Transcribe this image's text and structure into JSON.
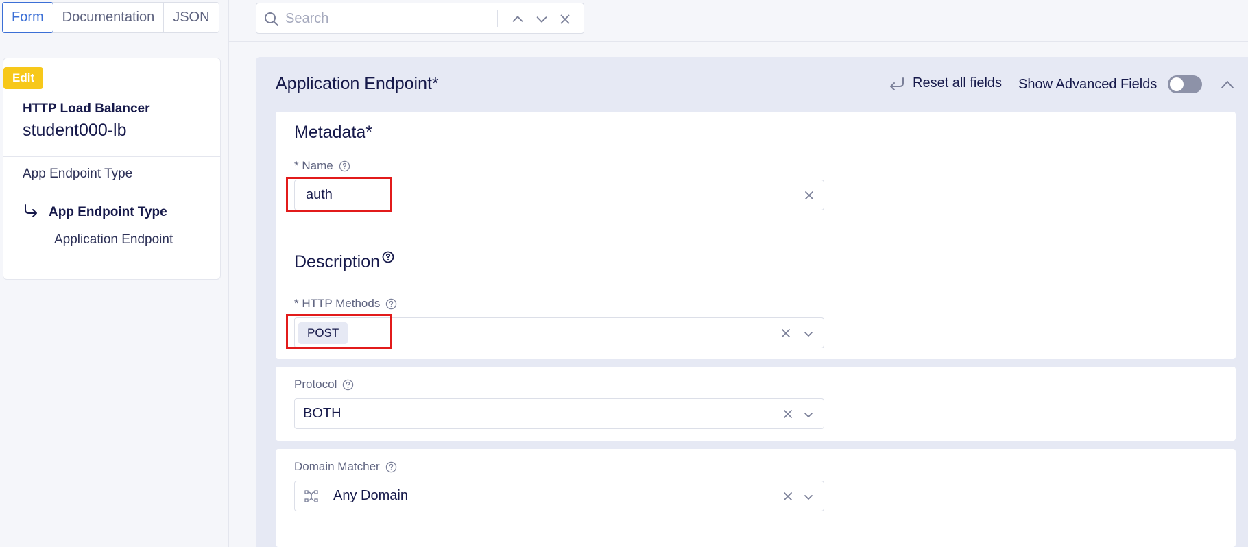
{
  "view_tabs": [
    "Form",
    "Documentation",
    "JSON"
  ],
  "nav": {
    "badge": "Edit",
    "object_type": "HTTP Load Balancer",
    "object_name": "student000-lb",
    "section": "App Endpoint Type",
    "current": "App Endpoint Type",
    "sub_item": "Application Endpoint"
  },
  "search": {
    "placeholder": "Search"
  },
  "panel": {
    "title": "Application Endpoint*",
    "reset_label": "Reset all fields",
    "advanced_label": "Show Advanced Fields",
    "advanced_enabled": false
  },
  "metadata": {
    "heading": "Metadata*",
    "name_label": "* Name",
    "name_value": "auth"
  },
  "description": {
    "heading": "Description"
  },
  "http_methods": {
    "label": "* HTTP Methods",
    "selected": [
      "POST"
    ]
  },
  "protocol": {
    "label": "Protocol",
    "value": "BOTH"
  },
  "domain_matcher": {
    "label": "Domain Matcher",
    "value": "Any Domain"
  },
  "colors": {
    "accent": "#3b6fd6",
    "badge": "#f7c81a",
    "highlight": "#e21b1b",
    "text": "#16194a"
  },
  "icons": [
    "search-icon",
    "chevron-up-icon",
    "chevron-down-icon",
    "close-icon",
    "return-arrow-icon",
    "help-icon",
    "domain-matcher-icon"
  ]
}
